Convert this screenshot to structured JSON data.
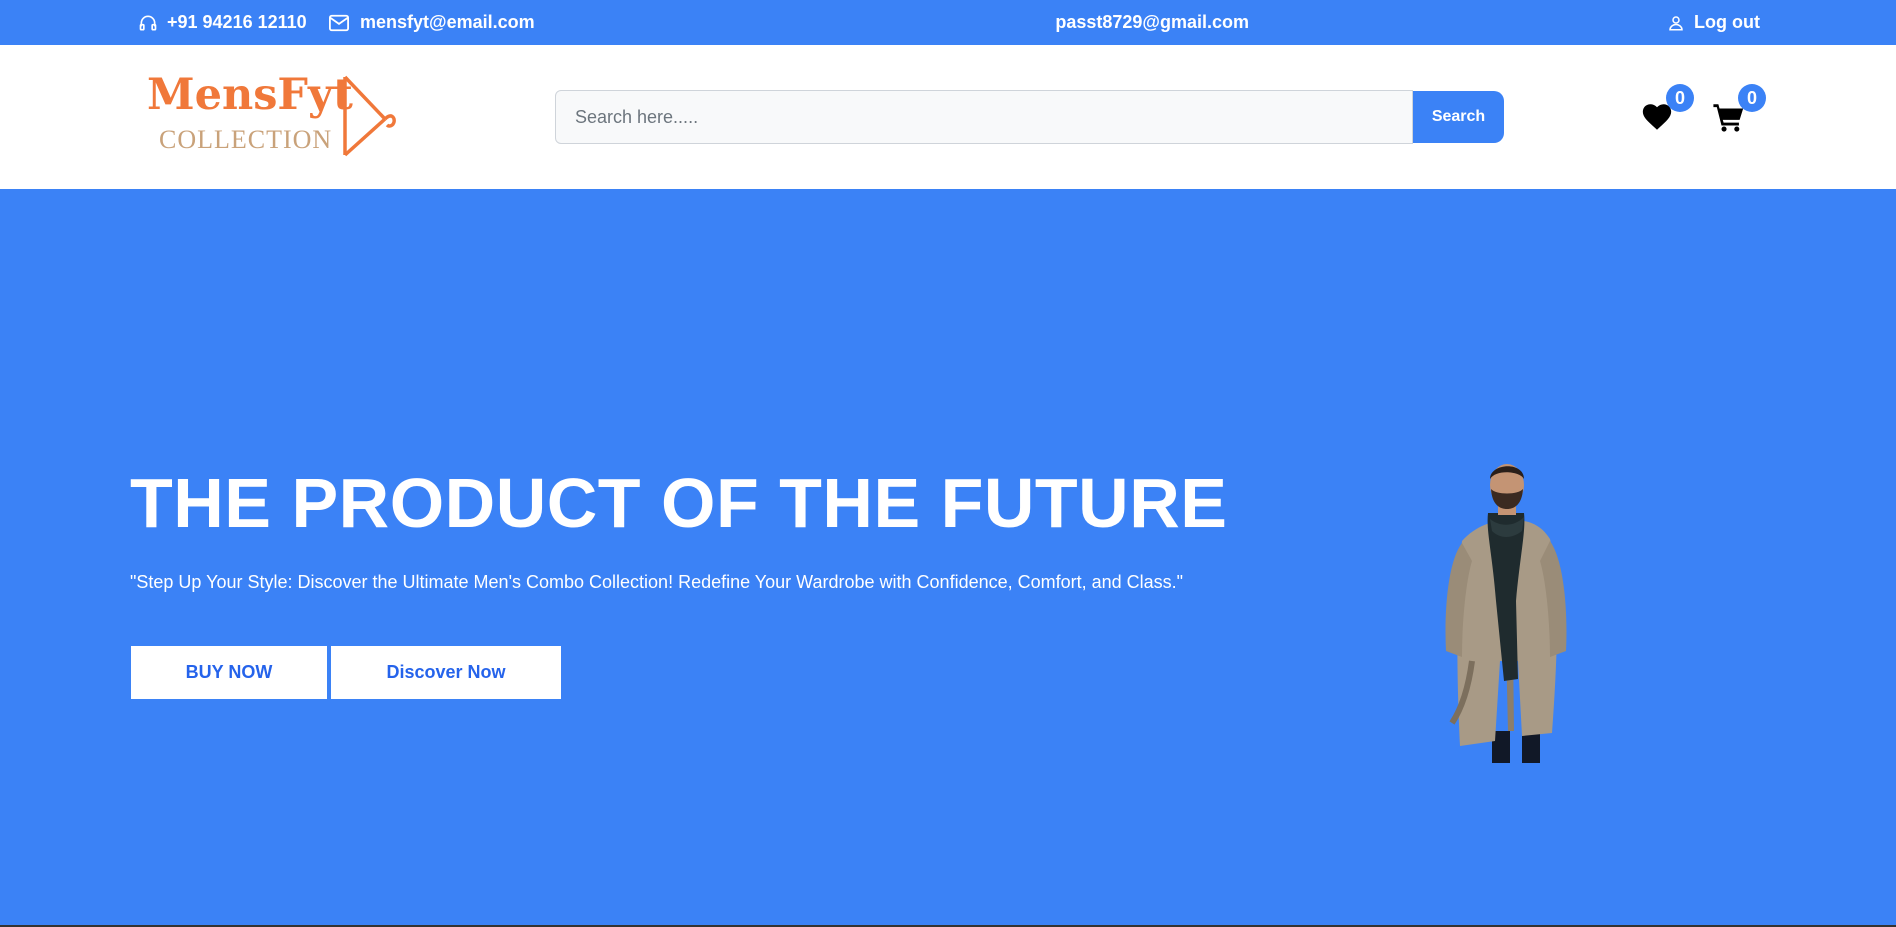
{
  "topbar": {
    "phone": "+91 94216 12110",
    "email": "mensfyt@email.com",
    "user_email": "passt8729@gmail.com",
    "logout_label": "Log out",
    "icons": {
      "phone": "headset-icon",
      "email": "envelope-icon",
      "user": "user-icon"
    }
  },
  "header": {
    "logo": {
      "brand": "MensFyt",
      "sub": "COLLECTION"
    },
    "search": {
      "placeholder": "Search here.....",
      "value": "",
      "button_label": "Search"
    },
    "wishlist": {
      "icon": "heart-icon",
      "count": "0"
    },
    "cart": {
      "icon": "cart-icon",
      "count": "0"
    }
  },
  "hero": {
    "title": "THE PRODUCT OF THE FUTURE",
    "text": "\"Step Up Your Style: Discover the Ultimate Men's Combo Collection! Redefine Your Wardrobe with Confidence, Comfort, and Class.\"",
    "buy_label": "BUY NOW",
    "discover_label": "Discover Now"
  },
  "colors": {
    "primary": "#3b82f6",
    "button_text": "#2563eb",
    "logo_orange": "#f0783a",
    "logo_tan": "#c9a27a"
  }
}
